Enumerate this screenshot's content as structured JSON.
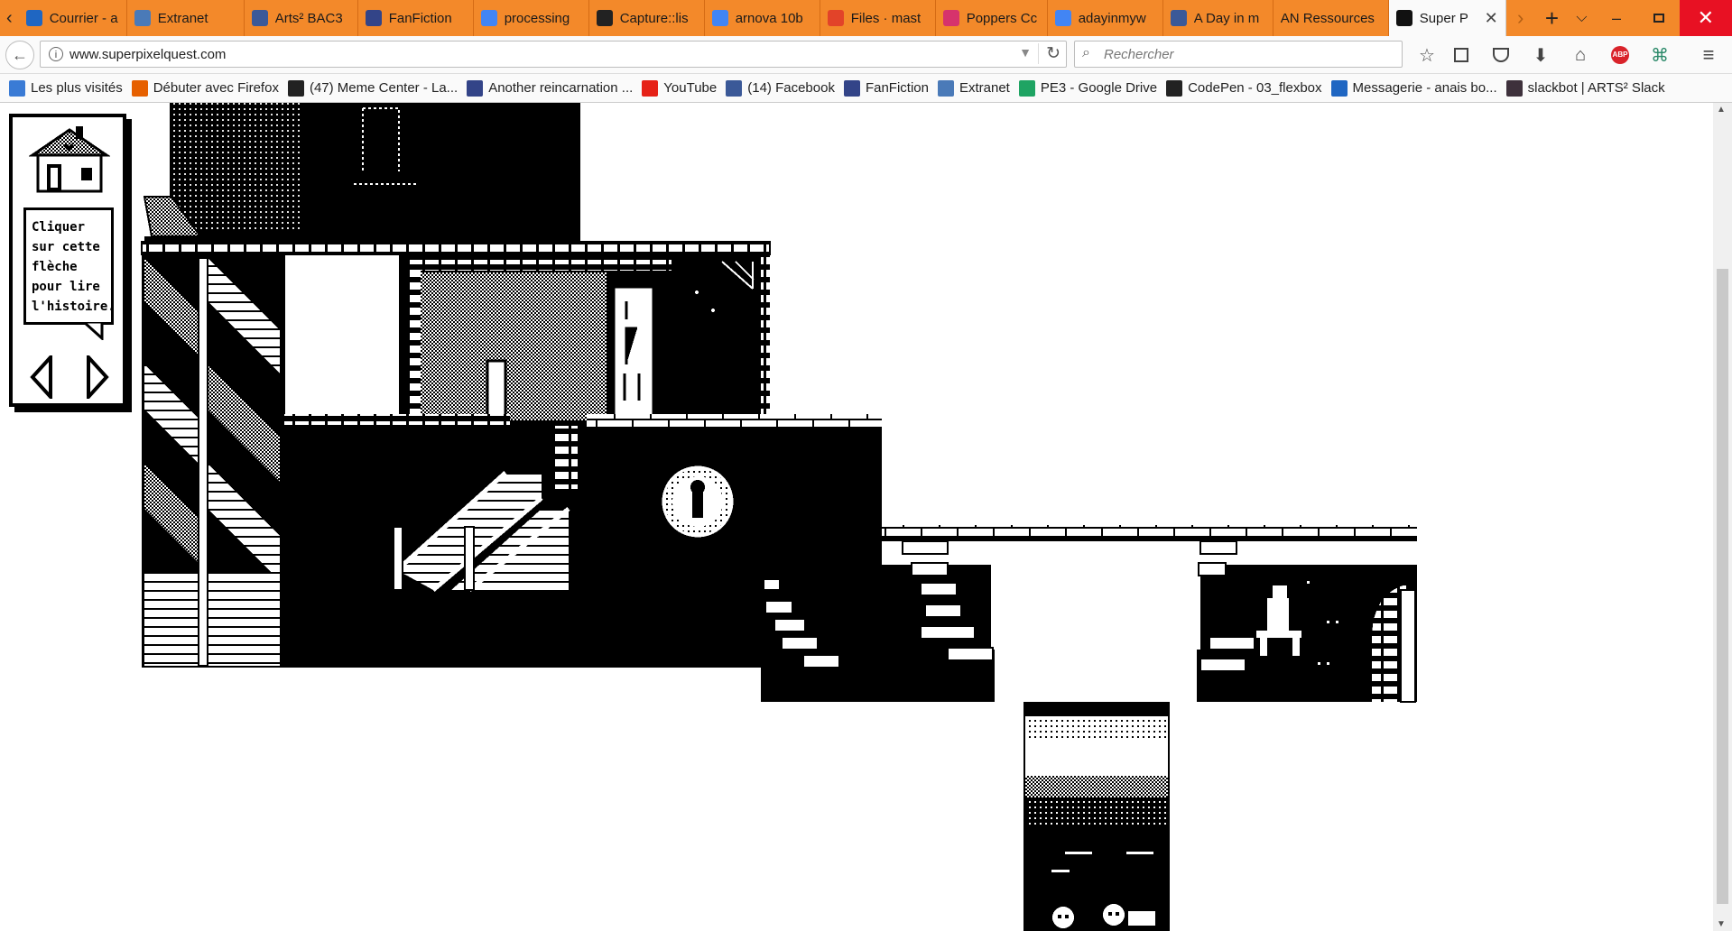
{
  "browser": {
    "tabs": [
      {
        "label": "Courrier - a",
        "icon": "outlook-icon",
        "color": "#1f66c2"
      },
      {
        "label": "Extranet",
        "icon": "extranet-icon",
        "color": "#4a7ab8"
      },
      {
        "label": "Arts² BAC3",
        "icon": "facebook-icon",
        "color": "#3b5998"
      },
      {
        "label": "FanFiction",
        "icon": "fanfiction-icon",
        "color": "#334488"
      },
      {
        "label": "processing",
        "icon": "google-icon",
        "color": "#4285f4"
      },
      {
        "label": "Capture::lis",
        "icon": "p-icon",
        "color": "#222222"
      },
      {
        "label": "arnova 10b",
        "icon": "google-icon",
        "color": "#4285f4"
      },
      {
        "label": "Files · mast",
        "icon": "gitlab-icon",
        "color": "#e24329"
      },
      {
        "label": "Poppers Cc",
        "icon": "poppers-icon",
        "color": "#d6336c"
      },
      {
        "label": "adayinmyw",
        "icon": "google-icon",
        "color": "#4285f4"
      },
      {
        "label": "A Day in m",
        "icon": "facebook-icon",
        "color": "#3b5998"
      },
      {
        "label": "AN Ressources",
        "icon": "none",
        "color": "#f3892a"
      },
      {
        "label": "Super P",
        "icon": "superpixel-icon",
        "color": "#111111",
        "active": true
      }
    ],
    "url": "www.superpixelquest.com",
    "search_placeholder": "Rechercher",
    "bookmarks": [
      {
        "label": "Les plus visités",
        "icon": "most-visited-icon",
        "color": "#3a7bd5"
      },
      {
        "label": "Débuter avec Firefox",
        "icon": "firefox-icon",
        "color": "#e66000"
      },
      {
        "label": "(47) Meme Center - La...",
        "icon": "memecenter-icon",
        "color": "#222222"
      },
      {
        "label": "Another reincarnation ...",
        "icon": "fanfiction-icon",
        "color": "#334488"
      },
      {
        "label": "YouTube",
        "icon": "youtube-icon",
        "color": "#e62117"
      },
      {
        "label": "(14) Facebook",
        "icon": "facebook-icon",
        "color": "#3b5998"
      },
      {
        "label": "FanFiction",
        "icon": "fanfiction-icon",
        "color": "#334488"
      },
      {
        "label": "Extranet",
        "icon": "extranet-icon",
        "color": "#4a7ab8"
      },
      {
        "label": "PE3 - Google Drive",
        "icon": "google-drive-icon",
        "color": "#1fa463"
      },
      {
        "label": "CodePen - 03_flexbox",
        "icon": "codepen-icon",
        "color": "#222222"
      },
      {
        "label": "Messagerie - anais bo...",
        "icon": "outlook-icon",
        "color": "#1f66c2"
      },
      {
        "label": "slackbot | ARTS² Slack",
        "icon": "slack-icon",
        "color": "#3e313c"
      }
    ]
  },
  "page": {
    "instruction": [
      "Cliquer",
      "sur cette",
      "flèche",
      "pour lire",
      "l'histoire."
    ]
  }
}
